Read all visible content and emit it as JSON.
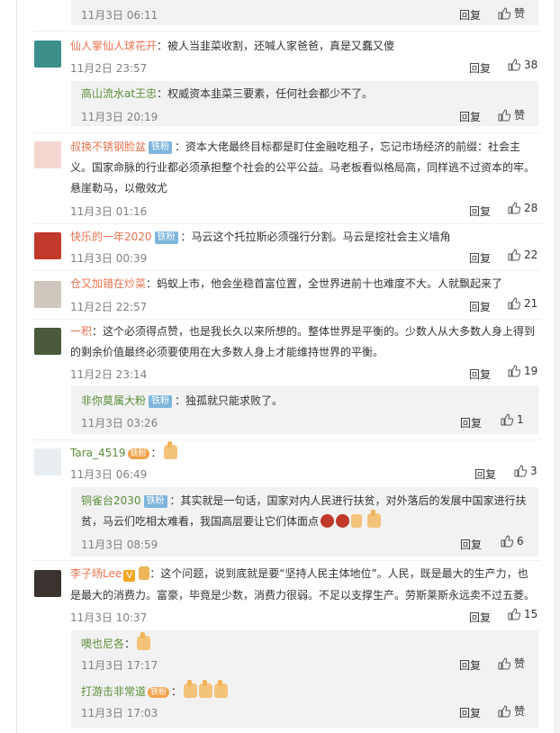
{
  "comments": [
    {
      "id": "c0",
      "time": "11月3日 06:11",
      "reply": "回复",
      "likes": "赞"
    },
    {
      "id": "c1",
      "user": "仙人掌仙人球花开",
      "text": "：被人当韭菜收割，还喊人家爸爸，真是又蠢又傻",
      "time": "11月2日 23:57",
      "reply": "回复",
      "likes": "38",
      "sub": [
        {
          "user": "高山流水at王忠",
          "text": "：权威资本韭菜三要素，任何社会都少不了。",
          "time": "11月3日 20:19",
          "reply": "回复",
          "likes": "赞"
        }
      ]
    },
    {
      "id": "c2",
      "user": "叔换不锈钢脸盆",
      "badge": "铁粉",
      "text_lines": [
        "：资本大佬最终目标都是盯住金融吃租子，忘记市场经济的前缀：社会主",
        "义。国家命脉的行业都必须承担整个社会的公平公益。马老板看似格局高，同样逃不过资本的牢。",
        "悬崖勒马，以儆效尤"
      ],
      "time": "11月3日 01:16",
      "reply": "回复",
      "likes": "28"
    },
    {
      "id": "c3",
      "user": "快乐的一年2020",
      "badge": "铁粉",
      "text": "：马云这个托拉斯必须强行分割。马云是挖社会主义墙角",
      "time": "11月3日 00:39",
      "reply": "回复",
      "likes": "22"
    },
    {
      "id": "c4",
      "user": "仓又加错在炒菜",
      "text": "：蚂蚁上市，他会坐稳首富位置，全世界进前十也难度不大。人就飘起来了",
      "time": "11月2日 22:57",
      "reply": "回复",
      "likes": "21"
    },
    {
      "id": "c5",
      "user": "一积",
      "text_lines": [
        "：这个必须得点赞，也是我长久以来所想的。整体世界是平衡的。少数人从大多数人身上得到",
        "的剩余价值最终必须要使用在大多数人身上才能维持世界的平衡。"
      ],
      "time": "11月2日 23:14",
      "reply": "回复",
      "likes": "19",
      "sub": [
        {
          "user": "非你莫属大粉",
          "badge": "铁粉",
          "text": "：独孤就只能求败了。",
          "time": "11月3日 03:26",
          "reply": "回复",
          "likes": "1"
        }
      ]
    },
    {
      "id": "c6",
      "user": "Tara_4519",
      "fanbadge": "铁粉",
      "text": "：",
      "time": "11月3日 06:49",
      "reply": "回复",
      "likes": "3",
      "sub": [
        {
          "user": "铜雀台2030",
          "badge": "铁粉",
          "text_lines": [
            "：其实就是一句话，国家对内人民进行扶贫，对外落后的发展中国家进行扶",
            "贫，马云们吃相太难看，我国高层要让它们体面点"
          ],
          "time": "11月3日 08:59",
          "reply": "回复",
          "likes": "6"
        }
      ]
    },
    {
      "id": "c7",
      "user": "李子旸Lee",
      "vbadge": "V",
      "text_lines": [
        "：这个问题，说到底就是要“坚持人民主体地位”。人民，既是最大的生产力，也",
        "是最大的消费力。富豪，毕竟是少数，消费力很弱。不足以支撑生产。劳斯莱斯永远卖不过五菱。"
      ],
      "time": "11月3日 10:37",
      "reply": "回复",
      "likes": "15",
      "sub": [
        {
          "user": "噢也尼各",
          "text": "：",
          "time": "11月3日 17:17",
          "reply": "回复",
          "likes": "赞"
        },
        {
          "user": "打游击非常道",
          "fanbadge": "铁粉",
          "text": "：",
          "time": "11月3日 17:03",
          "reply": "回复",
          "likes": "赞"
        }
      ]
    }
  ],
  "colors": {
    "username": "#eb7350",
    "sub_bg": "#f2f2f2",
    "badge": "#7eb5dc"
  }
}
